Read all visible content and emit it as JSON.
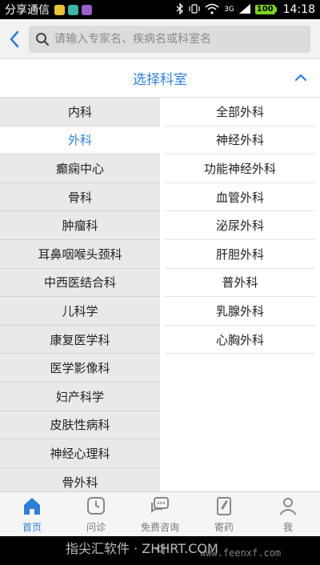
{
  "statusbar": {
    "carrier": "分享通信",
    "signal_label": "3G",
    "battery": "100",
    "time": "14:18"
  },
  "search": {
    "placeholder": "请输入专家名、疾病名或科室名"
  },
  "section": {
    "title": "选择科室"
  },
  "left_items": [
    {
      "label": "内科",
      "selected": false
    },
    {
      "label": "外科",
      "selected": true
    },
    {
      "label": "癫痫中心",
      "selected": false
    },
    {
      "label": "骨科",
      "selected": false
    },
    {
      "label": "肿瘤科",
      "selected": false
    },
    {
      "label": "耳鼻咽喉头颈科",
      "selected": false
    },
    {
      "label": "中西医结合科",
      "selected": false
    },
    {
      "label": "儿科学",
      "selected": false
    },
    {
      "label": "康复医学科",
      "selected": false
    },
    {
      "label": "医学影像科",
      "selected": false
    },
    {
      "label": "妇产科学",
      "selected": false
    },
    {
      "label": "皮肤性病科",
      "selected": false
    },
    {
      "label": "神经心理科",
      "selected": false
    },
    {
      "label": "骨外科",
      "selected": false
    }
  ],
  "right_items": [
    "全部外科",
    "神经外科",
    "功能神经外科",
    "血管外科",
    "泌尿外科",
    "肝胆外科",
    "普外科",
    "乳腺外科",
    "心胸外科"
  ],
  "tabs": [
    {
      "label": "首页",
      "icon": "home-icon",
      "active": true
    },
    {
      "label": "问诊",
      "icon": "clock-icon",
      "active": false
    },
    {
      "label": "免费咨询",
      "icon": "chat-icon",
      "active": false
    },
    {
      "label": "寄药",
      "icon": "medicine-icon",
      "active": false
    },
    {
      "label": "我",
      "icon": "user-icon",
      "active": false
    }
  ],
  "watermark": {
    "text": "指尖汇软件 · ZHHRT.COM",
    "text2": "www.feenxf.com"
  },
  "colors": {
    "accent": "#2f7fd6",
    "left_bg": "#e9e9e9"
  }
}
